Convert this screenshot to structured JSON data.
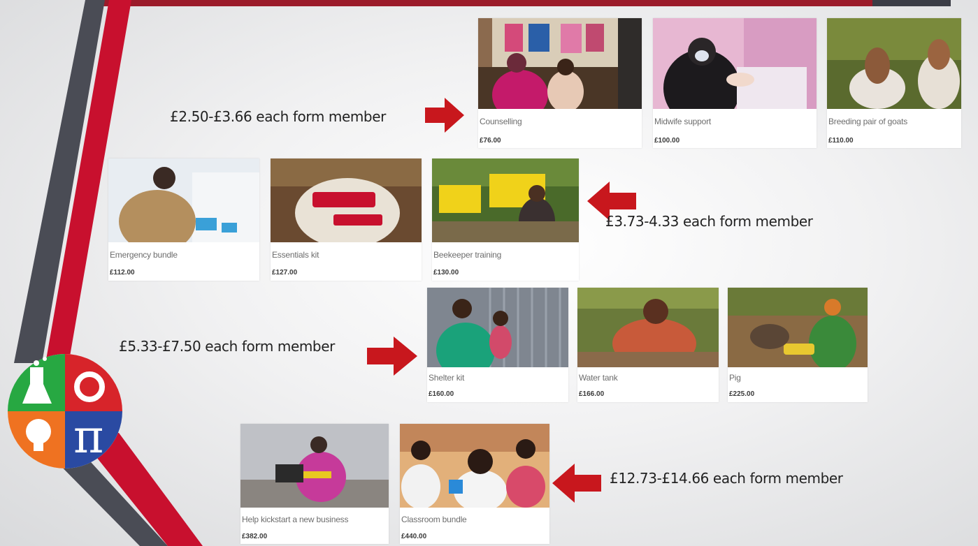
{
  "colors": {
    "accent_red": "#c8102e",
    "dark_stripe": "#3b3d46",
    "arrow_red": "#c8171d"
  },
  "tiers": [
    {
      "label": "£2.50-£3.66 each form member",
      "items": [
        {
          "name": "Counselling",
          "price": "£76.00"
        },
        {
          "name": "Midwife support",
          "price": "£100.00"
        },
        {
          "name": "Breeding pair of goats",
          "price": "£110.00"
        }
      ]
    },
    {
      "label": "£3.73-4.33 each form member",
      "items": [
        {
          "name": "Emergency bundle",
          "price": "£112.00"
        },
        {
          "name": "Essentials kit",
          "price": "£127.00"
        },
        {
          "name": "Beekeeper training",
          "price": "£130.00"
        }
      ]
    },
    {
      "label": "£5.33-£7.50 each form member",
      "items": [
        {
          "name": "Shelter kit",
          "price": "£160.00"
        },
        {
          "name": "Water tank",
          "price": "£166.00"
        },
        {
          "name": "Pig",
          "price": "£225.00"
        }
      ]
    },
    {
      "label": "£12.73-£14.66 each form member",
      "items": [
        {
          "name": "Help kickstart a new business",
          "price": "£382.00"
        },
        {
          "name": "Classroom bundle",
          "price": "£440.00"
        }
      ]
    }
  ],
  "icons": [
    "flask-icon",
    "gear-icon",
    "lightbulb-icon",
    "pi-icon",
    "arrow-right-icon",
    "arrow-left-icon"
  ]
}
